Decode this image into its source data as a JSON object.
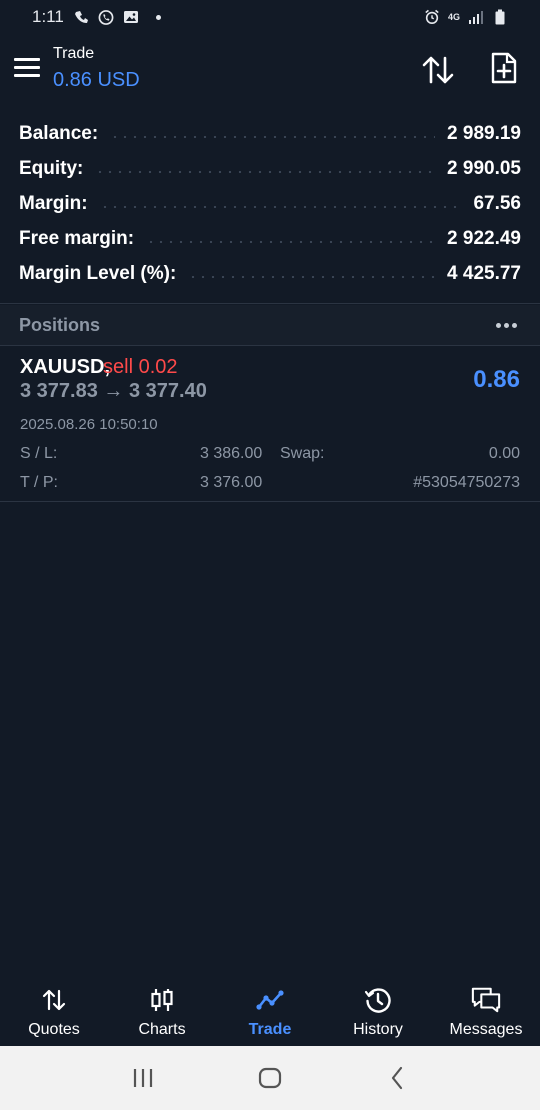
{
  "status_bar": {
    "time": "1:11",
    "network": "4G",
    "icons": [
      "wifi-calling-icon",
      "whatsapp-icon",
      "gallery-icon",
      "notification-dot",
      "alarm-icon",
      "signal-icon",
      "battery-icon"
    ]
  },
  "header": {
    "title": "Trade",
    "subtitle": "0.86 USD",
    "icons": [
      "menu-icon",
      "sort-icon",
      "new-order-icon"
    ]
  },
  "summary": [
    {
      "label": "Balance:",
      "value": "2 989.19"
    },
    {
      "label": "Equity:",
      "value": "2 990.05"
    },
    {
      "label": "Margin:",
      "value": "67.56"
    },
    {
      "label": "Free margin:",
      "value": "2 922.49"
    },
    {
      "label": "Margin Level (%):",
      "value": "4 425.77"
    }
  ],
  "positions": {
    "title": "Positions",
    "items": [
      {
        "symbol": "XAUUSD,",
        "side": "sell 0.02",
        "prices": "3 377.83 → 3 377.40",
        "profit": "0.86",
        "time": "2025.08.26 10:50:10",
        "sl_label": "S / L:",
        "sl_value": "3 386.00",
        "swap_label": "Swap:",
        "swap_value": "0.00",
        "tp_label": "T / P:",
        "tp_value": "3 376.00",
        "ticket": "#53054750273"
      }
    ]
  },
  "bottom_nav": [
    {
      "label": "Quotes",
      "icon": "quotes-icon",
      "active": false
    },
    {
      "label": "Charts",
      "icon": "charts-icon",
      "active": false
    },
    {
      "label": "Trade",
      "icon": "trade-icon",
      "active": true
    },
    {
      "label": "History",
      "icon": "history-icon",
      "active": false
    },
    {
      "label": "Messages",
      "icon": "messages-icon",
      "active": false
    }
  ],
  "colors": {
    "background": "#121a26",
    "accent": "#4a90ff",
    "sell": "#ff4a4a",
    "muted": "#8d97a5"
  }
}
